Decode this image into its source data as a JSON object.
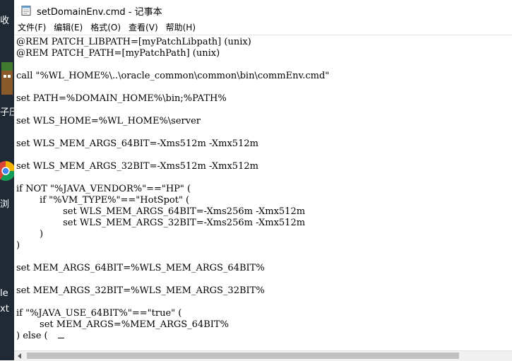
{
  "window": {
    "title": "setDomainEnv.cmd - 记事本",
    "icon": "notepad-icon"
  },
  "menubar": {
    "items": [
      {
        "label": "文件(F)"
      },
      {
        "label": "编辑(E)"
      },
      {
        "label": "格式(O)"
      },
      {
        "label": "查看(V)"
      },
      {
        "label": "帮助(H)"
      }
    ]
  },
  "desktop": {
    "labels": [
      "收",
      "子压",
      "浏",
      "le",
      "xt"
    ]
  },
  "editor": {
    "text": "@REM PATCH_LIBPATH=[myPatchLibpath] (unix)\n@REM PATCH_PATH=[myPatchPath] (unix)\n\ncall \"%WL_HOME%\\..\\oracle_common\\common\\bin\\commEnv.cmd\"\n\nset PATH=%DOMAIN_HOME%\\bin;%PATH%\n\nset WLS_HOME=%WL_HOME%\\server\n\nset WLS_MEM_ARGS_64BIT=-Xms512m -Xmx512m\n\nset WLS_MEM_ARGS_32BIT=-Xms512m -Xmx512m\n\nif NOT \"%JAVA_VENDOR%\"==\"HP\" (\n        if \"%VM_TYPE%\"==\"HotSpot\" (\n                set WLS_MEM_ARGS_64BIT=-Xms256m -Xmx512m\n                set WLS_MEM_ARGS_32BIT=-Xms256m -Xmx512m\n        )\n)\n\nset MEM_ARGS_64BIT=%WLS_MEM_ARGS_64BIT%\n\nset MEM_ARGS_32BIT=%WLS_MEM_ARGS_32BIT%\n\nif \"%JAVA_USE_64BIT%\"==\"true\" (\n        set MEM_ARGS=%MEM_ARGS_64BIT%\n) else ("
  },
  "colors": {
    "desktop_bg": "#1f2a35",
    "scroll_thumb": "#c1c1c1"
  }
}
